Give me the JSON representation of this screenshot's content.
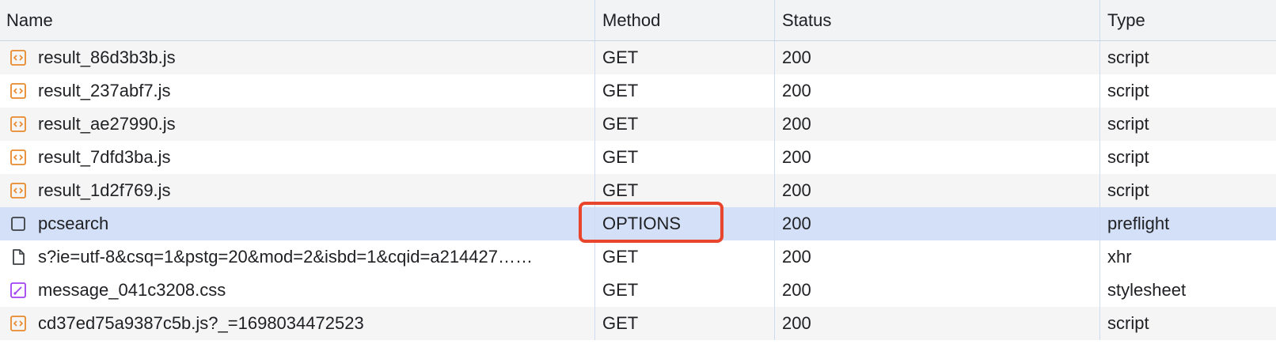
{
  "columns": {
    "name": "Name",
    "method": "Method",
    "status": "Status",
    "type": "Type"
  },
  "rows": [
    {
      "name": "result_86d3b3b.js",
      "method": "GET",
      "status": "200",
      "type": "script",
      "icon": "script-file-icon"
    },
    {
      "name": "result_237abf7.js",
      "method": "GET",
      "status": "200",
      "type": "script",
      "icon": "script-file-icon"
    },
    {
      "name": "result_ae27990.js",
      "method": "GET",
      "status": "200",
      "type": "script",
      "icon": "script-file-icon"
    },
    {
      "name": "result_7dfd3ba.js",
      "method": "GET",
      "status": "200",
      "type": "script",
      "icon": "script-file-icon"
    },
    {
      "name": "result_1d2f769.js",
      "method": "GET",
      "status": "200",
      "type": "script",
      "icon": "script-file-icon"
    },
    {
      "name": "pcsearch",
      "method": "OPTIONS",
      "status": "200",
      "type": "preflight",
      "icon": "preflight-checkbox-icon"
    },
    {
      "name": "s?ie=utf-8&csq=1&pstg=20&mod=2&isbd=1&cqid=a214427……",
      "method": "GET",
      "status": "200",
      "type": "xhr",
      "icon": "document-icon"
    },
    {
      "name": "message_041c3208.css",
      "method": "GET",
      "status": "200",
      "type": "stylesheet",
      "icon": "stylesheet-file-icon"
    },
    {
      "name": "cd37ed75a9387c5b.js?_=1698034472523",
      "method": "GET",
      "status": "200",
      "type": "script",
      "icon": "script-file-icon"
    }
  ],
  "colors": {
    "script_icon": "#e8892c",
    "stylesheet_icon": "#a142f4",
    "selected_row": "#d3e0f7",
    "highlight_border": "#e8452c"
  }
}
